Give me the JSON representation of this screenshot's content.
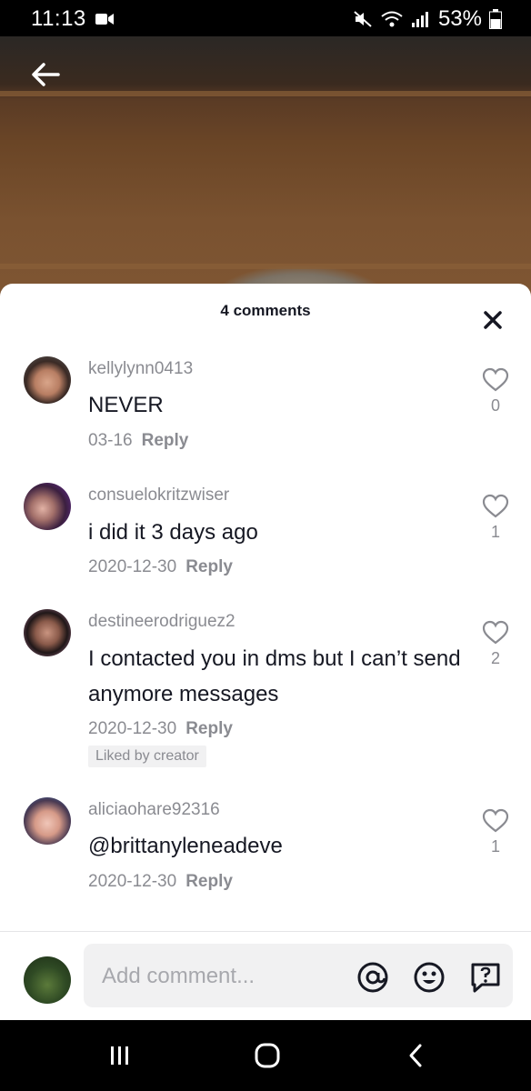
{
  "status_bar": {
    "time": "11:13",
    "battery": "53%"
  },
  "sheet": {
    "title": "4 comments"
  },
  "comments": [
    {
      "username": "kellylynn0413",
      "text": "NEVER",
      "date": "03-16",
      "reply": "Reply",
      "likes": "0"
    },
    {
      "username": "consuelokritzwiser",
      "text": "i did it 3 days ago",
      "date": "2020-12-30",
      "reply": "Reply",
      "likes": "1"
    },
    {
      "username": "destineerodriguez2",
      "text": "I contacted you in dms but I can’t send anymore messages",
      "date": "2020-12-30",
      "reply": "Reply",
      "likes": "2",
      "badge": "Liked by creator"
    },
    {
      "username": "aliciaohare92316",
      "text": "@brittanyleneadeve",
      "date": "2020-12-30",
      "reply": "Reply",
      "likes": "1"
    }
  ],
  "composer": {
    "placeholder": "Add comment..."
  },
  "icons": [
    "back-arrow-icon",
    "close-icon",
    "heart-icon",
    "at-icon",
    "emoji-icon",
    "question-icon",
    "recents-icon",
    "home-icon",
    "nav-back-icon"
  ],
  "colors": {
    "text": "#161823",
    "muted": "#8a8b91",
    "sheet": "#ffffff",
    "input_bg": "#f1f1f2"
  }
}
